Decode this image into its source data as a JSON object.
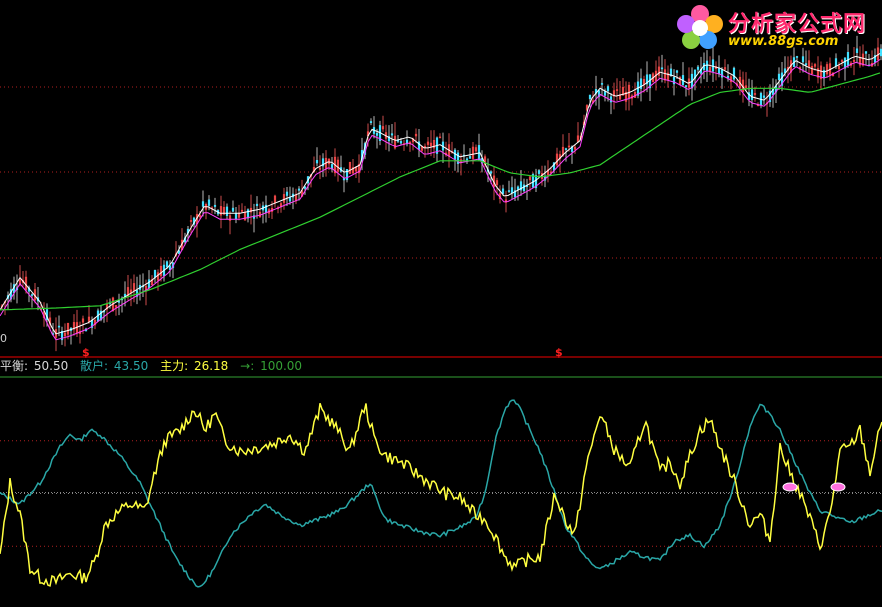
{
  "colors": {
    "background": "#000000",
    "grid": "#b02020",
    "divider": "#c00000",
    "up_candle": "#ff4040",
    "down_candle": "#40e0ff",
    "ma_white": "#ffffff",
    "ma_magenta": "#ff40ff",
    "ma_green": "#30d030",
    "balance": "#d8d8d8",
    "retail": "#2aa7a7",
    "main_force": "#ffff40",
    "arrow_line": "#35a035",
    "signal": "#ff2020"
  },
  "logo": {
    "title": "分析家公式网",
    "url": "www.88gs.com",
    "icon": "flower-logo-icon"
  },
  "price_panel": {
    "left_label": "0",
    "signals": [
      "$",
      "$"
    ]
  },
  "legend": {
    "balance_label": "平衡: ",
    "balance_value": "50.50",
    "retail_label": "散户: ",
    "retail_value": "43.50",
    "main_label": "主力: ",
    "main_value": "26.18",
    "arrow_label": "→: ",
    "arrow_value": "100.00"
  },
  "chart_data": [
    {
      "type": "candlestick",
      "title": "",
      "grid": true,
      "series": [
        {
          "name": "",
          "kind": "close_trend",
          "x": [
            0,
            20,
            40,
            55,
            70,
            90,
            110,
            130,
            150,
            170,
            190,
            205,
            220,
            240,
            260,
            280,
            300,
            315,
            330,
            345,
            360,
            370,
            380,
            395,
            410,
            425,
            440,
            460,
            480,
            495,
            505,
            520,
            535,
            550,
            565,
            580,
            590,
            600,
            615,
            630,
            645,
            660,
            675,
            690,
            705,
            720,
            735,
            750,
            765,
            780,
            795,
            810,
            825,
            840,
            855,
            870,
            882
          ],
          "y": [
            2530,
            2610,
            2550,
            2470,
            2480,
            2500,
            2540,
            2570,
            2600,
            2640,
            2730,
            2790,
            2770,
            2770,
            2780,
            2800,
            2820,
            2880,
            2900,
            2870,
            2890,
            2980,
            2970,
            2950,
            2960,
            2930,
            2940,
            2910,
            2920,
            2840,
            2810,
            2830,
            2850,
            2880,
            2920,
            2950,
            3050,
            3080,
            3060,
            3070,
            3090,
            3120,
            3110,
            3090,
            3140,
            3130,
            3110,
            3060,
            3050,
            3100,
            3150,
            3130,
            3120,
            3140,
            3160,
            3150,
            3170
          ]
        },
        {
          "name": "",
          "kind": "ma_long",
          "x": [
            0,
            60,
            100,
            150,
            200,
            240,
            280,
            320,
            360,
            400,
            440,
            480,
            510,
            540,
            570,
            600,
            630,
            660,
            690,
            720,
            750,
            780,
            810,
            840,
            870,
            882
          ],
          "y": [
            2530,
            2535,
            2540,
            2580,
            2630,
            2680,
            2720,
            2760,
            2810,
            2860,
            2900,
            2900,
            2870,
            2860,
            2870,
            2890,
            2940,
            2990,
            3040,
            3070,
            3080,
            3080,
            3070,
            3090,
            3110,
            3120
          ]
        }
      ]
    },
    {
      "type": "line",
      "title": "",
      "ylim": [
        0,
        100
      ],
      "grid": true,
      "series": [
        {
          "name": "平衡",
          "values_const": 50.5
        },
        {
          "name": "散户",
          "x": [
            0,
            20,
            40,
            60,
            70,
            80,
            90,
            100,
            120,
            140,
            160,
            175,
            190,
            200,
            215,
            230,
            250,
            265,
            280,
            300,
            320,
            340,
            355,
            370,
            385,
            400,
            420,
            440,
            460,
            475,
            485,
            495,
            505,
            512,
            520,
            530,
            540,
            555,
            565,
            575,
            585,
            595,
            605,
            615,
            630,
            645,
            660,
            675,
            690,
            705,
            720,
            735,
            750,
            760,
            770,
            780,
            790,
            800,
            810,
            820,
            830,
            840,
            850,
            860,
            870,
            882
          ],
          "y": [
            50,
            45,
            55,
            72,
            78,
            75,
            80,
            78,
            68,
            55,
            35,
            20,
            10,
            5,
            15,
            30,
            40,
            45,
            40,
            35,
            38,
            42,
            48,
            55,
            38,
            35,
            32,
            30,
            34,
            38,
            50,
            75,
            90,
            95,
            90,
            80,
            70,
            50,
            35,
            28,
            20,
            15,
            15,
            18,
            22,
            20,
            18,
            28,
            30,
            25,
            35,
            55,
            82,
            92,
            88,
            80,
            70,
            60,
            50,
            42,
            40,
            38,
            36,
            38,
            40,
            42
          ]
        },
        {
          "name": "主力",
          "values_current": 26.18,
          "x": [
            0,
            10,
            20,
            30,
            40,
            55,
            70,
            85,
            95,
            105,
            115,
            130,
            145,
            155,
            165,
            180,
            195,
            205,
            215,
            225,
            240,
            260,
            275,
            290,
            305,
            320,
            335,
            350,
            365,
            375,
            385,
            400,
            415,
            430,
            445,
            460,
            475,
            485,
            495,
            505,
            515,
            525,
            540,
            555,
            565,
            575,
            585,
            600,
            615,
            630,
            645,
            660,
            670,
            680,
            690,
            700,
            710,
            720,
            735,
            750,
            760,
            770,
            780,
            790,
            800,
            810,
            820,
            830,
            840,
            850,
            860,
            870,
            882
          ],
          "y": [
            20,
            55,
            40,
            15,
            10,
            8,
            12,
            10,
            18,
            35,
            40,
            45,
            42,
            60,
            75,
            80,
            90,
            80,
            88,
            75,
            70,
            72,
            74,
            78,
            70,
            90,
            82,
            70,
            92,
            75,
            68,
            65,
            60,
            55,
            50,
            48,
            40,
            38,
            30,
            20,
            15,
            18,
            20,
            50,
            38,
            30,
            60,
            88,
            70,
            62,
            85,
            60,
            65,
            55,
            68,
            80,
            85,
            72,
            55,
            35,
            40,
            28,
            72,
            60,
            50,
            38,
            25,
            40,
            70,
            72,
            80,
            60,
            85
          ]
        }
      ]
    }
  ]
}
